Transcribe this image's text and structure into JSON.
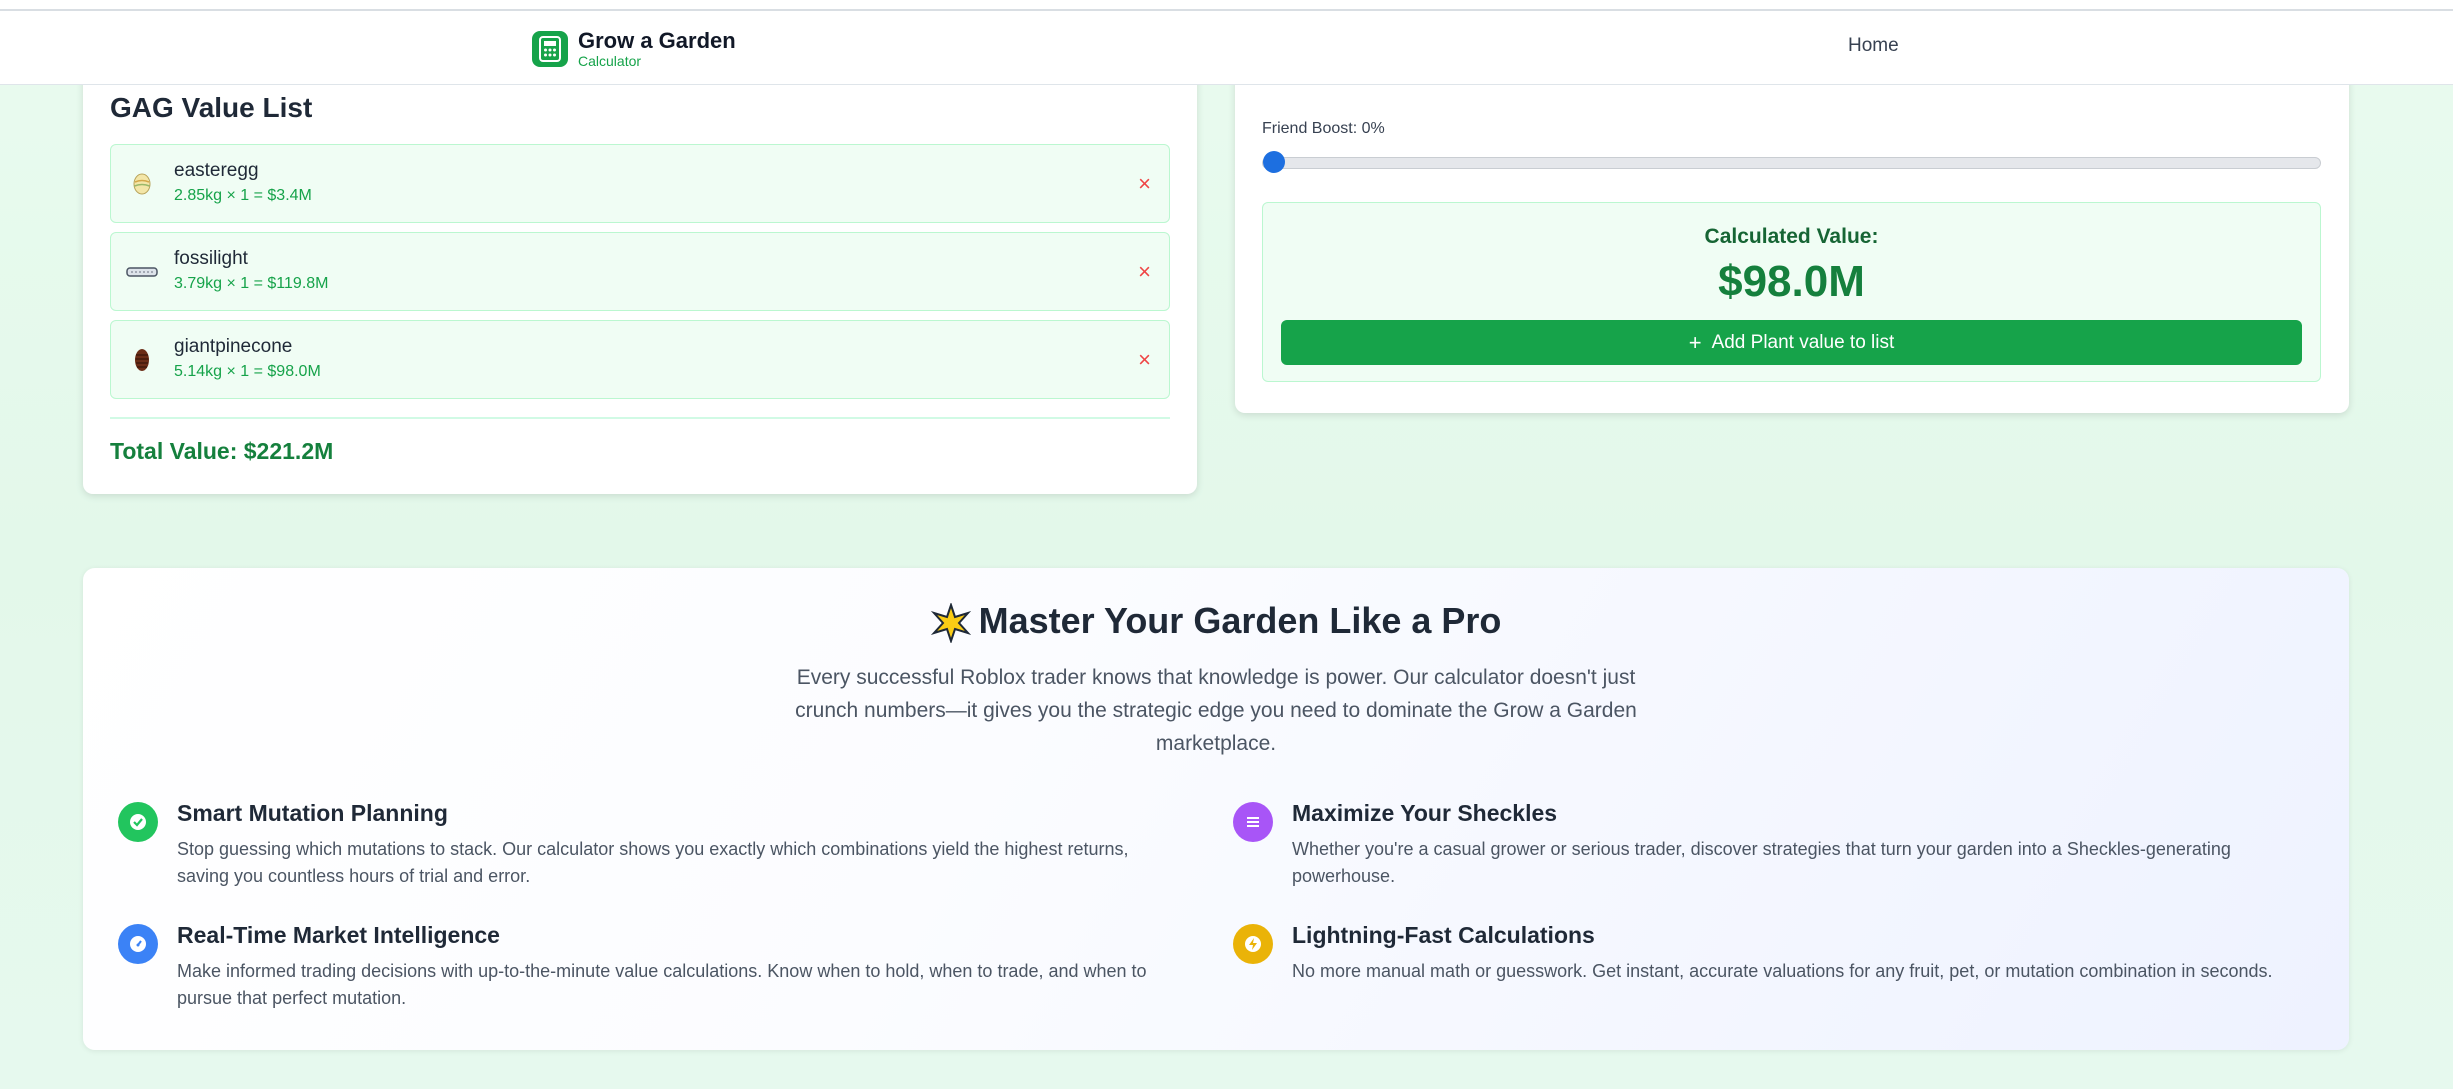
{
  "nav": {
    "brand_title": "Grow a Garden",
    "brand_subtitle": "Calculator",
    "home": "Home"
  },
  "value_list": {
    "title": "GAG Value List",
    "items": [
      {
        "name": "easteregg",
        "calc": "2.85kg × 1 = $3.4M",
        "icon": "easter-egg-icon"
      },
      {
        "name": "fossilight",
        "calc": "3.79kg × 1 = $119.8M",
        "icon": "fossil-light-icon"
      },
      {
        "name": "giantpinecone",
        "calc": "5.14kg × 1 = $98.0M",
        "icon": "pinecone-icon"
      }
    ],
    "remove_symbol": "×",
    "total": "Total Value: $221.2M"
  },
  "calculator": {
    "friend_boost_label": "Friend Boost: 0%",
    "friend_boost_value": 0,
    "calculated_label": "Calculated Value:",
    "calculated_value": "$98.0M",
    "add_button": "Add Plant value to list"
  },
  "features": {
    "title": "Master Your Garden Like a Pro",
    "description": "Every successful Roblox trader knows that knowledge is power. Our calculator doesn't just crunch numbers—it gives you the strategic edge you need to dominate the Grow a Garden marketplace.",
    "items": [
      {
        "name": "Smart Mutation Planning",
        "text": "Stop guessing which mutations to stack. Our calculator shows you exactly which combinations yield the highest returns, saving you countless hours of trial and error.",
        "color": "#22c55e",
        "icon": "check-circle-icon"
      },
      {
        "name": "Maximize Your Sheckles",
        "text": "Whether you're a casual grower or serious trader, discover strategies that turn your garden into a Sheckles-generating powerhouse.",
        "color": "#a855f7",
        "icon": "list-icon"
      },
      {
        "name": "Real-Time Market Intelligence",
        "text": "Make informed trading decisions with up-to-the-minute value calculations. Know when to hold, when to trade, and when to pursue that perfect mutation.",
        "color": "#3b82f6",
        "icon": "gauge-icon"
      },
      {
        "name": "Lightning-Fast Calculations",
        "text": "No more manual math or guesswork. Get instant, accurate valuations for any fruit, pet, or mutation combination in seconds.",
        "color": "#eab308",
        "icon": "lightning-icon"
      }
    ]
  },
  "colors": {
    "primary": "#16a34a",
    "total_text": "#15803d",
    "remove": "#ef4444",
    "slider": "#1d6fe0"
  }
}
